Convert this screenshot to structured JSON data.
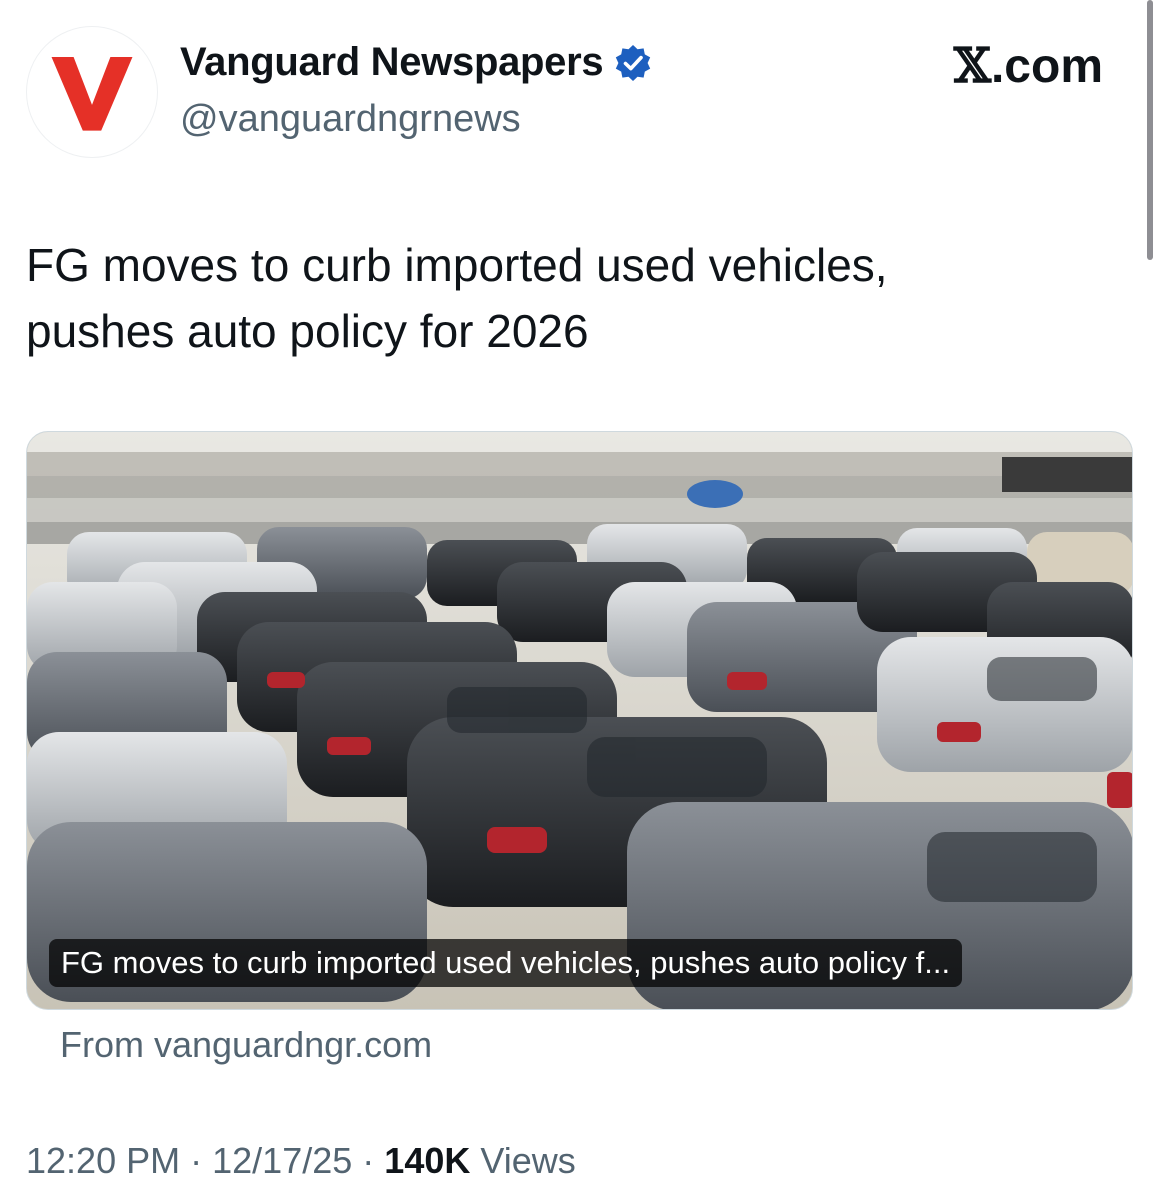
{
  "account": {
    "display_name": "Vanguard Newspapers",
    "handle": "@vanguardngrnews",
    "avatar_letter": "V",
    "avatar_color": "#e53027",
    "verified_color": "#1d5fbf"
  },
  "brand": {
    "x_glyph": "𝕏",
    "suffix": ".com"
  },
  "tweet": {
    "text": "FG moves to curb imported used vehicles,\npushes auto policy for 2026"
  },
  "card": {
    "caption": "FG moves to curb imported used vehicles, pushes auto policy f...",
    "source": "From vanguardngr.com"
  },
  "meta": {
    "time": "12:20 PM",
    "date": "12/17/25",
    "views_count": "140K",
    "views_label": "Views",
    "separator": "·"
  }
}
